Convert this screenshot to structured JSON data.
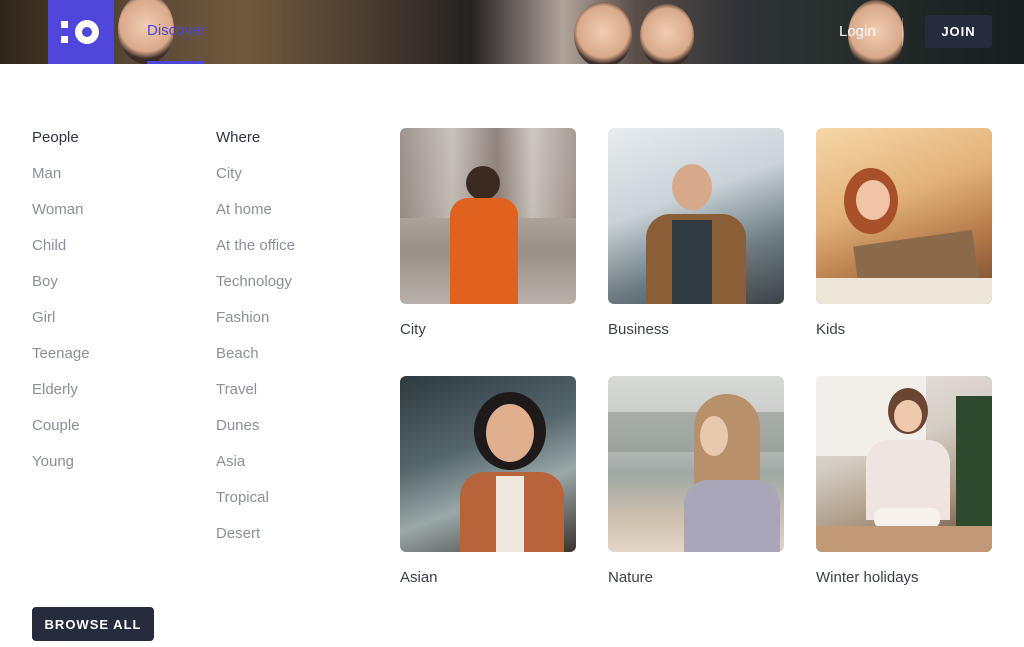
{
  "header": {
    "nav": {
      "discover_label": "Discover"
    },
    "auth": {
      "login_label": "Login",
      "join_label": "JOIN"
    },
    "colors": {
      "brand": "#5046d9",
      "dark_button": "#262c3d"
    }
  },
  "categories": {
    "people": {
      "heading": "People",
      "items": [
        "Man",
        "Woman",
        "Child",
        "Boy",
        "Girl",
        "Teenage",
        "Elderly",
        "Couple",
        "Young"
      ]
    },
    "where": {
      "heading": "Where",
      "items": [
        "City",
        "At home",
        "At the office",
        "Technology",
        "Fashion",
        "Beach",
        "Travel",
        "Dunes",
        "Asia",
        "Tropical",
        "Desert"
      ]
    }
  },
  "browse_all_label": "BROWSE ALL",
  "tiles": [
    {
      "caption": "City"
    },
    {
      "caption": "Business"
    },
    {
      "caption": "Kids"
    },
    {
      "caption": "Asian"
    },
    {
      "caption": "Nature"
    },
    {
      "caption": "Winter holidays"
    }
  ]
}
